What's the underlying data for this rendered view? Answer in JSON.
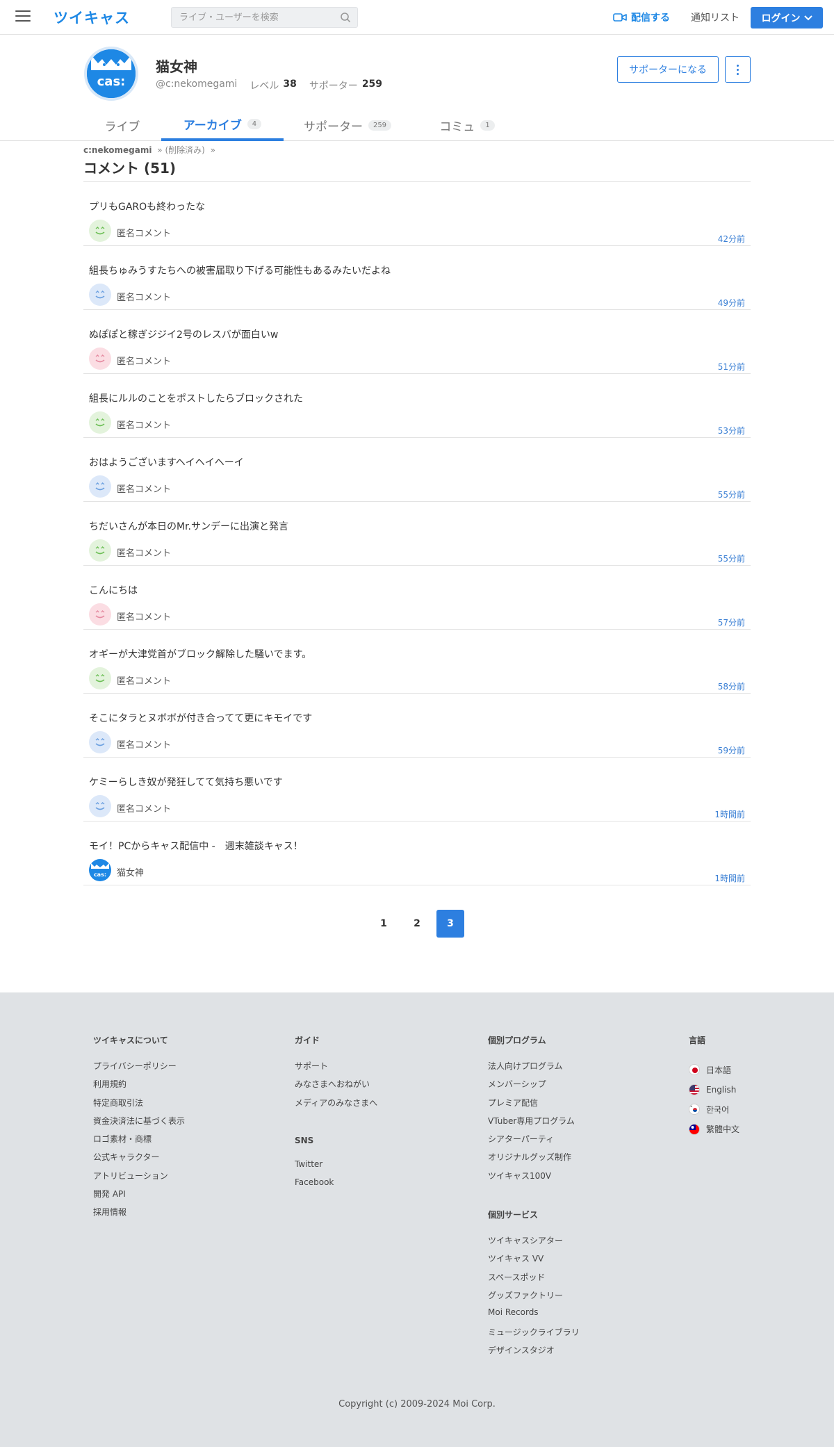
{
  "header": {
    "logo": "ツイキャス",
    "search_placeholder": "ライブ・ユーザーを検索",
    "broadcast_label": "配信する",
    "notify_label": "通知リスト",
    "login_label": "ログイン"
  },
  "profile": {
    "avatar_text": "cas:",
    "name": "猫女神",
    "handle": "@c:nekomegami",
    "level_label": "レベル",
    "level": "38",
    "supporter_label": "サポーター",
    "supporters": "259",
    "become_supporter": "サポーターになる"
  },
  "tabs": [
    {
      "label": "ライブ",
      "count": ""
    },
    {
      "label": "アーカイブ",
      "count": "4"
    },
    {
      "label": "サポーター",
      "count": "259"
    },
    {
      "label": "コミュ",
      "count": "1"
    }
  ],
  "breadcrumb": {
    "user": "c:nekomegami",
    "sep1": "»",
    "deleted": "(削除済み)",
    "sep2": "»"
  },
  "section_title": "コメント (51)",
  "comments": [
    {
      "text": "プリもGAROも終わったな",
      "author": "匿名コメント",
      "time": "42分前",
      "avatar": "green"
    },
    {
      "text": "組長ちゅみうすたちへの被害届取り下げる可能性もあるみたいだよね",
      "author": "匿名コメント",
      "time": "49分前",
      "avatar": "blue"
    },
    {
      "text": "ぬぽぽと稼ぎジジイ2号のレスバが面白いw",
      "author": "匿名コメント",
      "time": "51分前",
      "avatar": "pink"
    },
    {
      "text": "組長にルルのことをポストしたらブロックされた",
      "author": "匿名コメント",
      "time": "53分前",
      "avatar": "green"
    },
    {
      "text": "おはようございますヘイヘイヘーイ",
      "author": "匿名コメント",
      "time": "55分前",
      "avatar": "blue"
    },
    {
      "text": "ちだいさんが本日のMr.サンデーに出演と発言",
      "author": "匿名コメント",
      "time": "55分前",
      "avatar": "green"
    },
    {
      "text": "こんにちは",
      "author": "匿名コメント",
      "time": "57分前",
      "avatar": "pink"
    },
    {
      "text": "オギーが大津党首がブロック解除した騒いでます。",
      "author": "匿名コメント",
      "time": "58分前",
      "avatar": "green"
    },
    {
      "text": "そこにタラとヌボボが付き合ってて更にキモイです",
      "author": "匿名コメント",
      "time": "59分前",
      "avatar": "blue"
    },
    {
      "text": "ケミーらしき奴が発狂してて気持ち悪いです",
      "author": "匿名コメント",
      "time": "1時間前",
      "avatar": "blue"
    },
    {
      "text": "モイ！PCからキャス配信中 -　週末雑談キャス！",
      "author": "猫女神",
      "time": "1時間前",
      "avatar": "owner"
    }
  ],
  "pagination": [
    "1",
    "2",
    "3"
  ],
  "pagination_active": "3",
  "footer": {
    "about_title": "ツイキャスについて",
    "about_links": [
      "プライバシーポリシー",
      "利用規約",
      "特定商取引法",
      "資金決済法に基づく表示",
      "ロゴ素材・商標",
      "公式キャラクター",
      "アトリビューション",
      "開発 API",
      "採用情報"
    ],
    "guide_title": "ガイド",
    "guide_links": [
      "サポート",
      "みなさまへおねがい",
      "メディアのみなさまへ"
    ],
    "sns_title": "SNS",
    "sns_links": [
      "Twitter",
      "Facebook"
    ],
    "program_title": "個別プログラム",
    "program_links": [
      "法人向けプログラム",
      "メンバーシップ",
      "プレミア配信",
      "VTuber専用プログラム",
      "シアターパーティ",
      "オリジナルグッズ制作",
      "ツイキャス100V"
    ],
    "service_title": "個別サービス",
    "service_links": [
      "ツイキャスシアター",
      "ツイキャス VV",
      "スペースポッド",
      "グッズファクトリー",
      "Moi Records",
      "ミュージックライブラリ",
      "デザインスタジオ"
    ],
    "lang_title": "言語",
    "languages": [
      {
        "label": "日本語",
        "flag": "jp-flag-icon"
      },
      {
        "label": "English",
        "flag": "us-flag-icon"
      },
      {
        "label": "한국어",
        "flag": "kr-flag-icon"
      },
      {
        "label": "繁體中文",
        "flag": "tw-flag-icon"
      }
    ],
    "copyright": "Copyright (c) 2009-2024 Moi Corp."
  },
  "colors": {
    "accent": "#2d7fe0",
    "avatar_green": "#e3f3dc",
    "avatar_blue": "#dce8f9",
    "avatar_pink": "#fbdde3"
  }
}
